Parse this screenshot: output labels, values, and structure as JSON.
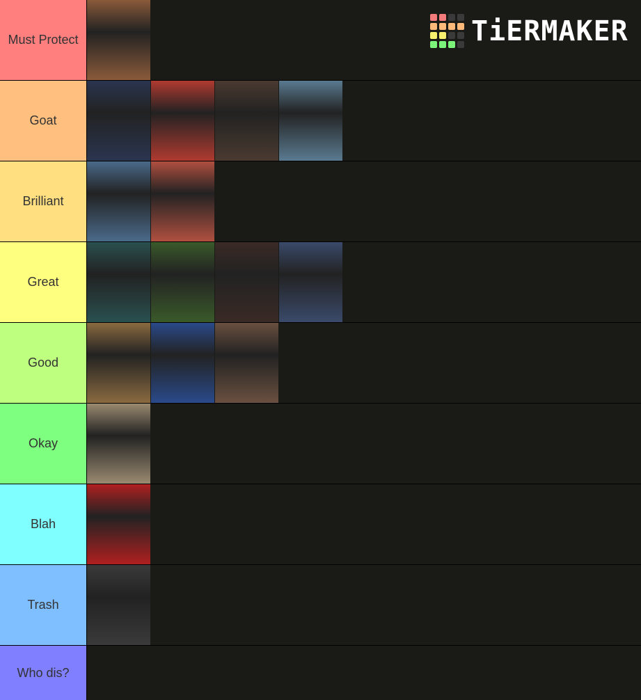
{
  "logo": {
    "text": "TiERMAKER",
    "grid": [
      "#f47b7b",
      "#f47b7b",
      "#3a3a3a",
      "#3a3a3a",
      "#fcb97a",
      "#fcb97a",
      "#fcb97a",
      "#fcb97a",
      "#f7f06e",
      "#f7f06e",
      "#3a3a3a",
      "#3a3a3a",
      "#7cf47c",
      "#7cf47c",
      "#7cf47c",
      "#3a3a3a"
    ]
  },
  "tiers": [
    {
      "label": "Must Protect",
      "color": "#ff7f7f",
      "items": [
        "#8a5a3a"
      ]
    },
    {
      "label": "Goat",
      "color": "#ffbf7f",
      "items": [
        "#2a3550",
        "#b03a30",
        "#4a3a30",
        "#5a7a90"
      ]
    },
    {
      "label": "Brilliant",
      "color": "#ffdf7f",
      "items": [
        "#4a6a8a",
        "#b05040"
      ]
    },
    {
      "label": "Great",
      "color": "#ffff7f",
      "items": [
        "#2a5050",
        "#3a5a2a",
        "#3a2a25",
        "#3a4a6a"
      ]
    },
    {
      "label": "Good",
      "color": "#bfff7f",
      "items": [
        "#8a6a40",
        "#2a4a8a",
        "#6a5040"
      ]
    },
    {
      "label": "Okay",
      "color": "#7fff7f",
      "items": [
        "#9a8a70"
      ]
    },
    {
      "label": "Blah",
      "color": "#7fffff",
      "items": [
        "#b02020"
      ]
    },
    {
      "label": "Trash",
      "color": "#7fbfff",
      "items": [
        "#3a3a3a"
      ]
    },
    {
      "label": "Who dis?",
      "color": "#7f7fff",
      "items": []
    }
  ]
}
